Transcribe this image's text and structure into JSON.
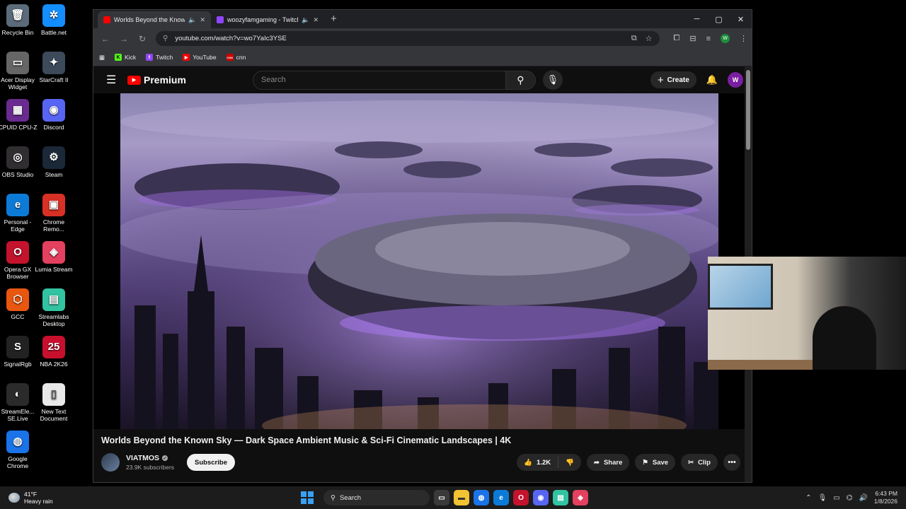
{
  "desktop": {
    "icons": [
      {
        "label": "Recycle Bin",
        "glyph": "🗑",
        "color": "#5b6b7a"
      },
      {
        "label": "Battle.net",
        "glyph": "✲",
        "color": "#148eff"
      },
      {
        "label": "Acer Display Widget",
        "glyph": "▭",
        "color": "#666666"
      },
      {
        "label": "StarCraft II",
        "glyph": "✦",
        "color": "#3c4a5a"
      },
      {
        "label": "CPUID CPU-Z",
        "glyph": "▦",
        "color": "#6a2b90"
      },
      {
        "label": "Discord",
        "glyph": "◉",
        "color": "#5865f2"
      },
      {
        "label": "OBS Studio",
        "glyph": "◎",
        "color": "#302e31"
      },
      {
        "label": "Steam",
        "glyph": "⚙",
        "color": "#1b2838"
      },
      {
        "label": "Personal - Edge",
        "glyph": "e",
        "color": "#0c7bd8"
      },
      {
        "label": "Chrome Remo...",
        "glyph": "▣",
        "color": "#d93025"
      },
      {
        "label": "Opera GX Browser",
        "glyph": "O",
        "color": "#c4132d"
      },
      {
        "label": "Lumia Stream",
        "glyph": "◈",
        "color": "#e4405f"
      },
      {
        "label": "GCC",
        "glyph": "⬡",
        "color": "#e8560f"
      },
      {
        "label": "Streamlabs Desktop",
        "glyph": "▤",
        "color": "#31c3a2"
      },
      {
        "label": "SignalRgb",
        "glyph": "S",
        "color": "#222222"
      },
      {
        "label": "NBA 2K26",
        "glyph": "25",
        "color": "#c8102e"
      },
      {
        "label": "StreamEle... SE.Live",
        "glyph": "◐",
        "color": "#2b2b2b"
      },
      {
        "label": "New Text Document",
        "glyph": "▯",
        "color": "#e9e9e9"
      },
      {
        "label": "Google Chrome",
        "glyph": "◍",
        "color": "#1a73e8"
      }
    ]
  },
  "browser": {
    "tabs": [
      {
        "title": "Worlds Beyond the Known",
        "color": "#ff0000",
        "active": true
      },
      {
        "title": "woozyfamgaming - Twitch",
        "color": "#9146ff",
        "active": false
      }
    ],
    "url": "youtube.com/watch?v=wo7YaIc3YSE",
    "bookmarks": [
      {
        "label": "Kick",
        "glyph": "K",
        "color": "#53fc18"
      },
      {
        "label": "Twitch",
        "glyph": "t",
        "color": "#9146ff"
      },
      {
        "label": "YouTube",
        "glyph": "▶",
        "color": "#ff0000"
      },
      {
        "label": "cnn",
        "glyph": "CNN",
        "color": "#cc0000"
      }
    ],
    "profile_initial": "W"
  },
  "youtube": {
    "logo_text": "Premium",
    "search_placeholder": "Search",
    "create_label": "Create",
    "avatar_initial": "W",
    "video_title": "Worlds Beyond the Known Sky — Dark Space Ambient Music & Sci-Fi Cinematic Landscapes | 4K",
    "channel_name": "VIATMOS",
    "subscribers": "23.9K subscribers",
    "subscribe_label": "Subscribe",
    "likes": "1.2K",
    "share_label": "Share",
    "save_label": "Save",
    "clip_label": "Clip"
  },
  "taskbar": {
    "temperature": "41°F",
    "weather": "Heavy rain",
    "search_label": "Search",
    "time": "6:43 PM",
    "date": "1/8/2026"
  }
}
